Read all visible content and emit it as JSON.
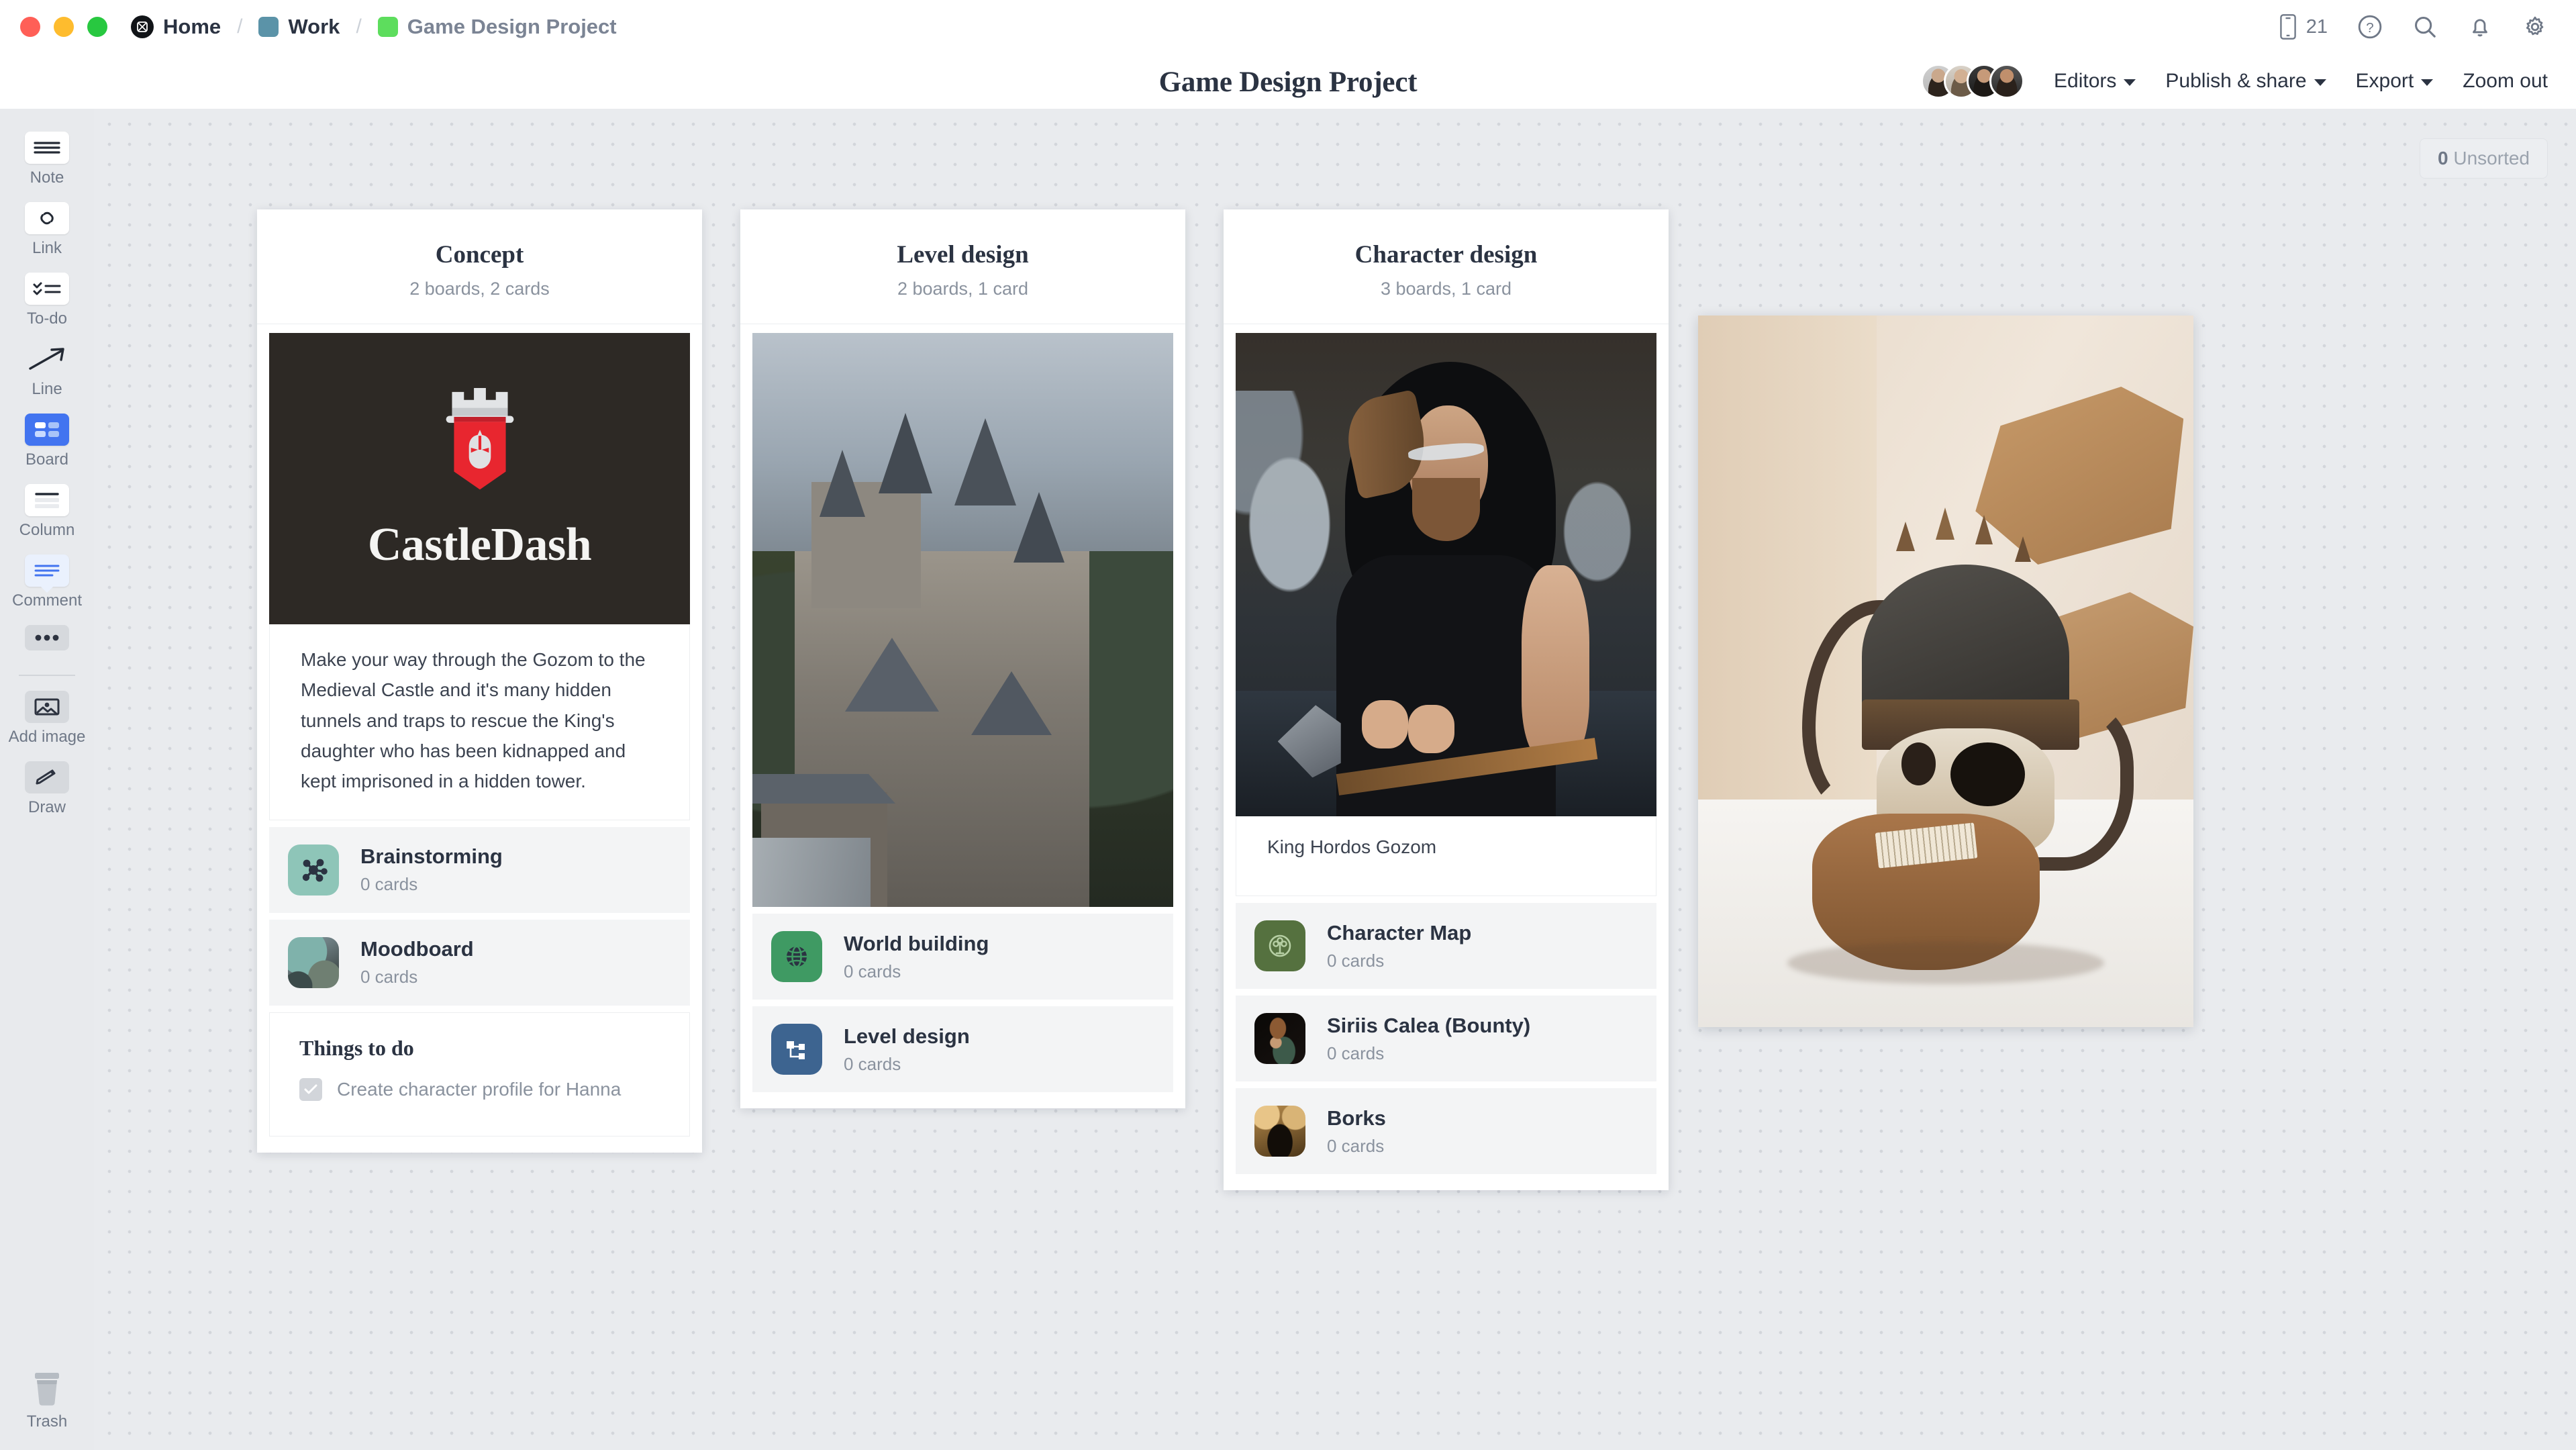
{
  "window": {
    "traffic_lights": [
      "close",
      "minimize",
      "maximize"
    ]
  },
  "breadcrumb": {
    "home_label": "Home",
    "workspace_label": "Work",
    "workspace_color": "#5b93a8",
    "project_label": "Game Design Project",
    "project_color": "#5ddd5d",
    "separator": "/"
  },
  "topbar_right": {
    "device_count": "21",
    "icons": [
      "mobile-icon",
      "help-icon",
      "search-icon",
      "bell-icon",
      "gear-icon"
    ]
  },
  "header": {
    "title": "Game Design Project",
    "menus": [
      {
        "label": "Editors",
        "caret": true
      },
      {
        "label": "Publish & share",
        "caret": true
      },
      {
        "label": "Export",
        "caret": true
      },
      {
        "label": "Zoom out",
        "caret": false
      }
    ],
    "avatar_count": 4
  },
  "toolbar": {
    "items": [
      {
        "label": "Note",
        "icon": "note-icon",
        "state": "default"
      },
      {
        "label": "Link",
        "icon": "link-icon",
        "state": "default"
      },
      {
        "label": "To-do",
        "icon": "todo-icon",
        "state": "default"
      },
      {
        "label": "Line",
        "icon": "line-icon",
        "state": "plain"
      },
      {
        "label": "Board",
        "icon": "board-icon",
        "state": "active"
      },
      {
        "label": "Column",
        "icon": "column-icon",
        "state": "default"
      },
      {
        "label": "Comment",
        "icon": "comment-icon",
        "state": "tint"
      },
      {
        "label": "",
        "icon": "more-dots-icon",
        "state": "dots"
      },
      {
        "label": "Add image",
        "icon": "image-icon",
        "state": "grey"
      },
      {
        "label": "Draw",
        "icon": "pencil-icon",
        "state": "grey"
      }
    ],
    "trash_label": "Trash"
  },
  "canvas": {
    "unsorted_count": "0",
    "unsorted_label": "Unsorted"
  },
  "columns": [
    {
      "title": "Concept",
      "subtitle": "2 boards, 2 cards",
      "hero": {
        "type": "logo",
        "brand": "CastleDash",
        "background": "#2d2925",
        "banner_color": "#e8262f"
      },
      "note": "Make your way through the Gozom to the Medieval Castle and it's many hidden tunnels and traps to rescue the King's daughter who has been kidnapped and kept imprisoned in a hidden tower.",
      "boards": [
        {
          "name": "Brainstorming",
          "count": "0 cards",
          "icon": "network-icon",
          "icon_bg": "#8ec5b8"
        },
        {
          "name": "Moodboard",
          "count": "0 cards",
          "icon": "moodboard-thumb",
          "icon_bg": "#6f8a84"
        }
      ],
      "todo": {
        "title": "Things to do",
        "items": [
          {
            "text": "Create character profile for Hanna",
            "checked": true
          }
        ]
      }
    },
    {
      "title": "Level design",
      "subtitle": "2 boards, 1 card",
      "hero": {
        "type": "photo",
        "subject": "medieval-castle-photo"
      },
      "boards": [
        {
          "name": "World building",
          "count": "0 cards",
          "icon": "globe-icon",
          "icon_bg": "#3f9a63"
        },
        {
          "name": "Level design",
          "count": "0 cards",
          "icon": "sitemap-icon",
          "icon_bg": "#3d6490"
        }
      ]
    },
    {
      "title": "Character design",
      "subtitle": "3 boards, 1 card",
      "hero": {
        "type": "photo",
        "subject": "viking-warrior-photo"
      },
      "caption": "King Hordos Gozom",
      "boards": [
        {
          "name": "Character Map",
          "count": "0 cards",
          "icon": "tree-circle-icon",
          "icon_bg": "#55713f"
        },
        {
          "name": "Siriis Calea (Bounty)",
          "count": "0 cards",
          "icon": "bounty-portrait-thumb",
          "icon_bg": "#120d0a"
        },
        {
          "name": "Borks",
          "count": "0 cards",
          "icon": "borks-portrait-thumb",
          "icon_bg": "#8a6030"
        }
      ]
    }
  ],
  "floating_image": {
    "name": "viking-skull-sculpture-photo",
    "alt": "Horned viking skull sculpture with wooden blocks"
  }
}
